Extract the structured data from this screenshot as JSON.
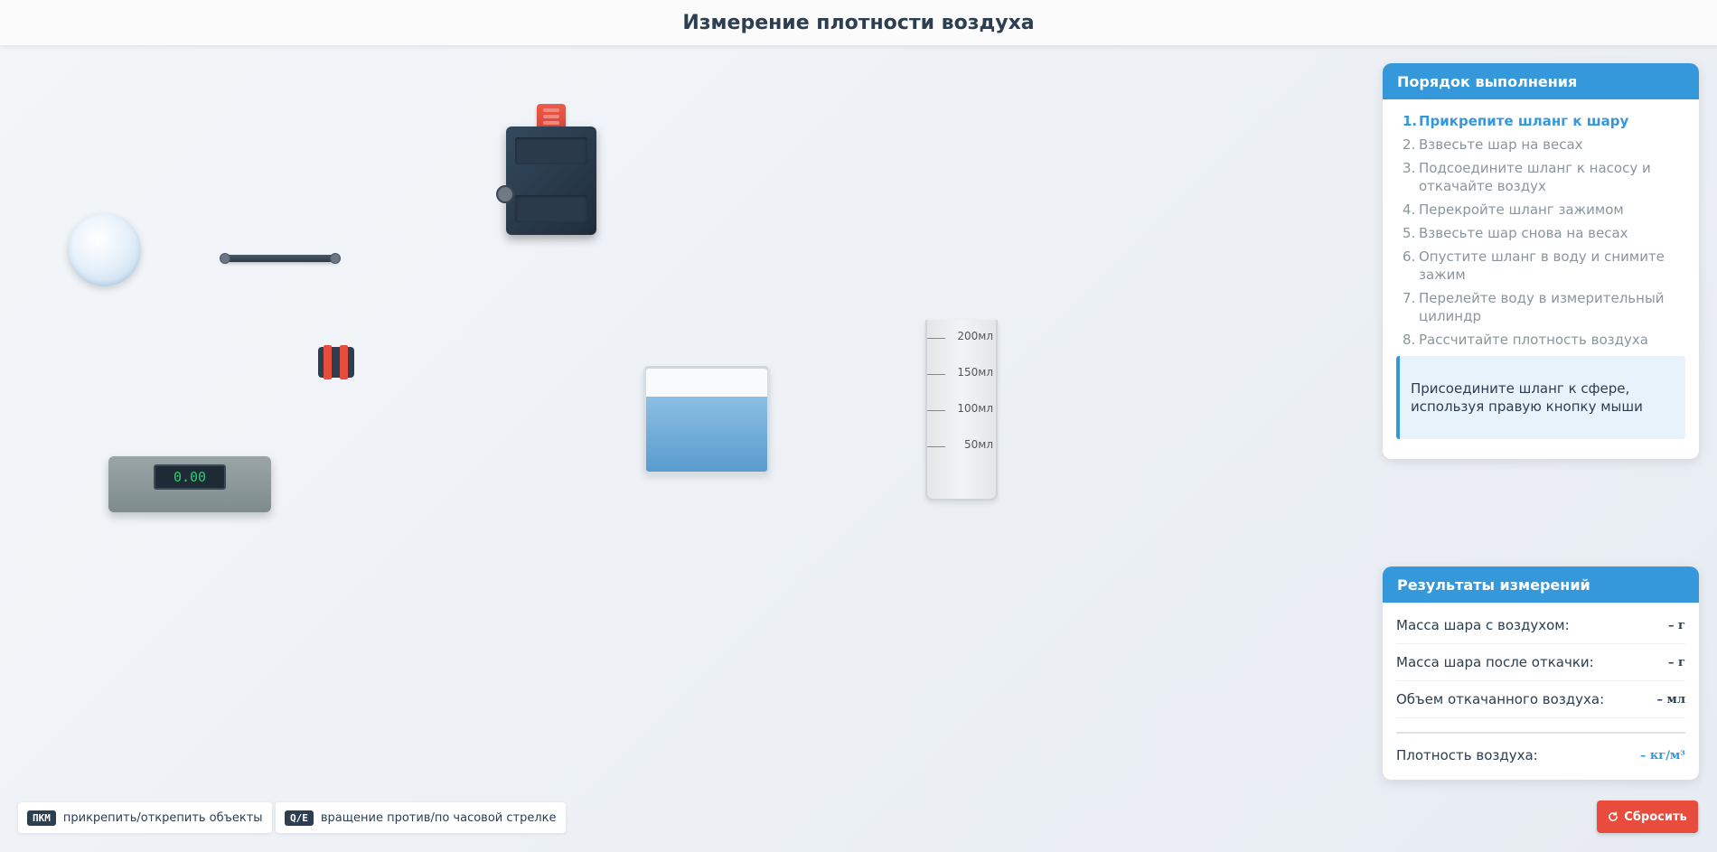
{
  "header": {
    "title": "Измерение плотности воздуха"
  },
  "scale": {
    "display": "0.00"
  },
  "cylinder": {
    "marks": [
      "200мл",
      "150мл",
      "100мл",
      "50мл"
    ]
  },
  "procedure": {
    "title": "Порядок выполнения",
    "steps": [
      {
        "num": "1.",
        "text": "Прикрепите шланг к шару"
      },
      {
        "num": "2.",
        "text": "Взвесьте шар на весах"
      },
      {
        "num": "3.",
        "text": "Подсоедините шланг к насосу и откачайте воздух"
      },
      {
        "num": "4.",
        "text": "Перекройте шланг зажимом"
      },
      {
        "num": "5.",
        "text": "Взвесьте шар снова на весах"
      },
      {
        "num": "6.",
        "text": "Опустите шланг в воду и снимите зажим"
      },
      {
        "num": "7.",
        "text": "Перелейте воду в измерительный цилиндр"
      },
      {
        "num": "8.",
        "text": "Рассчитайте плотность воздуха"
      }
    ],
    "hint": "Присоедините шланг к сфере, используя правую кнопку мыши"
  },
  "results": {
    "title": "Результаты измерений",
    "rows": [
      {
        "label": "Масса шара с воздухом:",
        "value": "– г"
      },
      {
        "label": "Масса шара после откачки:",
        "value": "– г"
      },
      {
        "label": "Объем откачанного воздуха:",
        "value": "– мл"
      }
    ],
    "density": {
      "label": "Плотность воздуха:",
      "value": "– кг/м³"
    }
  },
  "footer": {
    "attach": {
      "key": "ПКМ",
      "text": "прикрепить/открепить объекты"
    },
    "rotate": {
      "key": "Q/E",
      "text": "вращение против/по часовой стрелке"
    },
    "reset_label": "Сбросить"
  },
  "colors": {
    "accent": "#3498db",
    "danger": "#e74c3c",
    "dark": "#2c3e50"
  }
}
